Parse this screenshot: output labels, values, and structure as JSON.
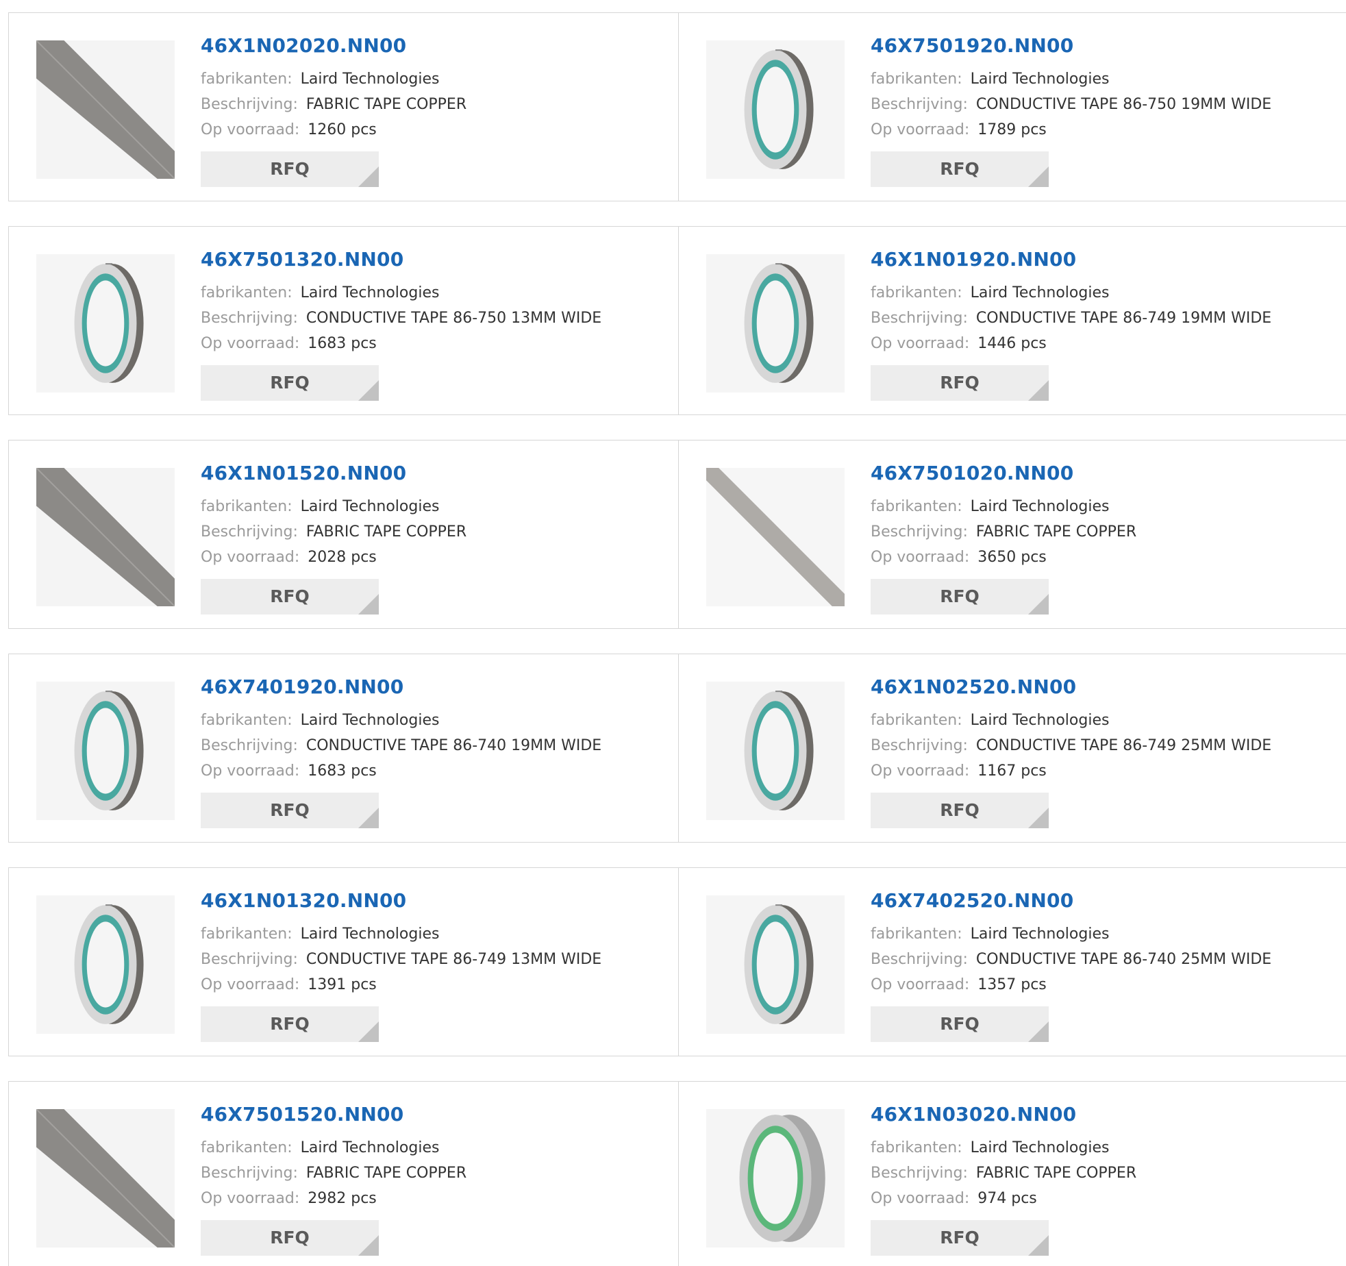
{
  "labels": {
    "manufacturer": "fabrikanten:",
    "description": "Beschrijving:",
    "stock": "Op voorraad:",
    "rfq": "RFQ"
  },
  "products": [
    {
      "part": "46X1N02020.NN00",
      "manufacturer": "Laird Technologies",
      "description": "FABRIC TAPE COPPER",
      "stock": "1260 pcs",
      "image": "strip"
    },
    {
      "part": "46X7501920.NN00",
      "manufacturer": "Laird Technologies",
      "description": "CONDUCTIVE TAPE 86-750 19MM WIDE",
      "stock": "1789 pcs",
      "image": "roll"
    },
    {
      "part": "46X7501320.NN00",
      "manufacturer": "Laird Technologies",
      "description": "CONDUCTIVE TAPE 86-750 13MM WIDE",
      "stock": "1683 pcs",
      "image": "roll"
    },
    {
      "part": "46X1N01920.NN00",
      "manufacturer": "Laird Technologies",
      "description": "CONDUCTIVE TAPE 86-749 19MM WIDE",
      "stock": "1446 pcs",
      "image": "roll"
    },
    {
      "part": "46X1N01520.NN00",
      "manufacturer": "Laird Technologies",
      "description": "FABRIC TAPE COPPER",
      "stock": "2028 pcs",
      "image": "strip"
    },
    {
      "part": "46X7501020.NN00",
      "manufacturer": "Laird Technologies",
      "description": "FABRIC TAPE COPPER",
      "stock": "3650 pcs",
      "image": "strip-thin"
    },
    {
      "part": "46X7401920.NN00",
      "manufacturer": "Laird Technologies",
      "description": "CONDUCTIVE TAPE 86-740 19MM WIDE",
      "stock": "1683 pcs",
      "image": "roll"
    },
    {
      "part": "46X1N02520.NN00",
      "manufacturer": "Laird Technologies",
      "description": "CONDUCTIVE TAPE 86-749 25MM WIDE",
      "stock": "1167 pcs",
      "image": "roll"
    },
    {
      "part": "46X1N01320.NN00",
      "manufacturer": "Laird Technologies",
      "description": "CONDUCTIVE TAPE 86-749 13MM WIDE",
      "stock": "1391 pcs",
      "image": "roll"
    },
    {
      "part": "46X7402520.NN00",
      "manufacturer": "Laird Technologies",
      "description": "CONDUCTIVE TAPE 86-740 25MM WIDE",
      "stock": "1357 pcs",
      "image": "roll"
    },
    {
      "part": "46X7501520.NN00",
      "manufacturer": "Laird Technologies",
      "description": "FABRIC TAPE COPPER",
      "stock": "2982 pcs",
      "image": "strip"
    },
    {
      "part": "46X1N03020.NN00",
      "manufacturer": "Laird Technologies",
      "description": "FABRIC TAPE COPPER",
      "stock": "974 pcs",
      "image": "roll-silver"
    }
  ],
  "colors": {
    "part_link": "#1a66b4",
    "label": "#9a9a9a",
    "value": "#333333",
    "button_bg": "#ededed",
    "button_text": "#5a5a5a",
    "border": "#d6d6d6"
  }
}
